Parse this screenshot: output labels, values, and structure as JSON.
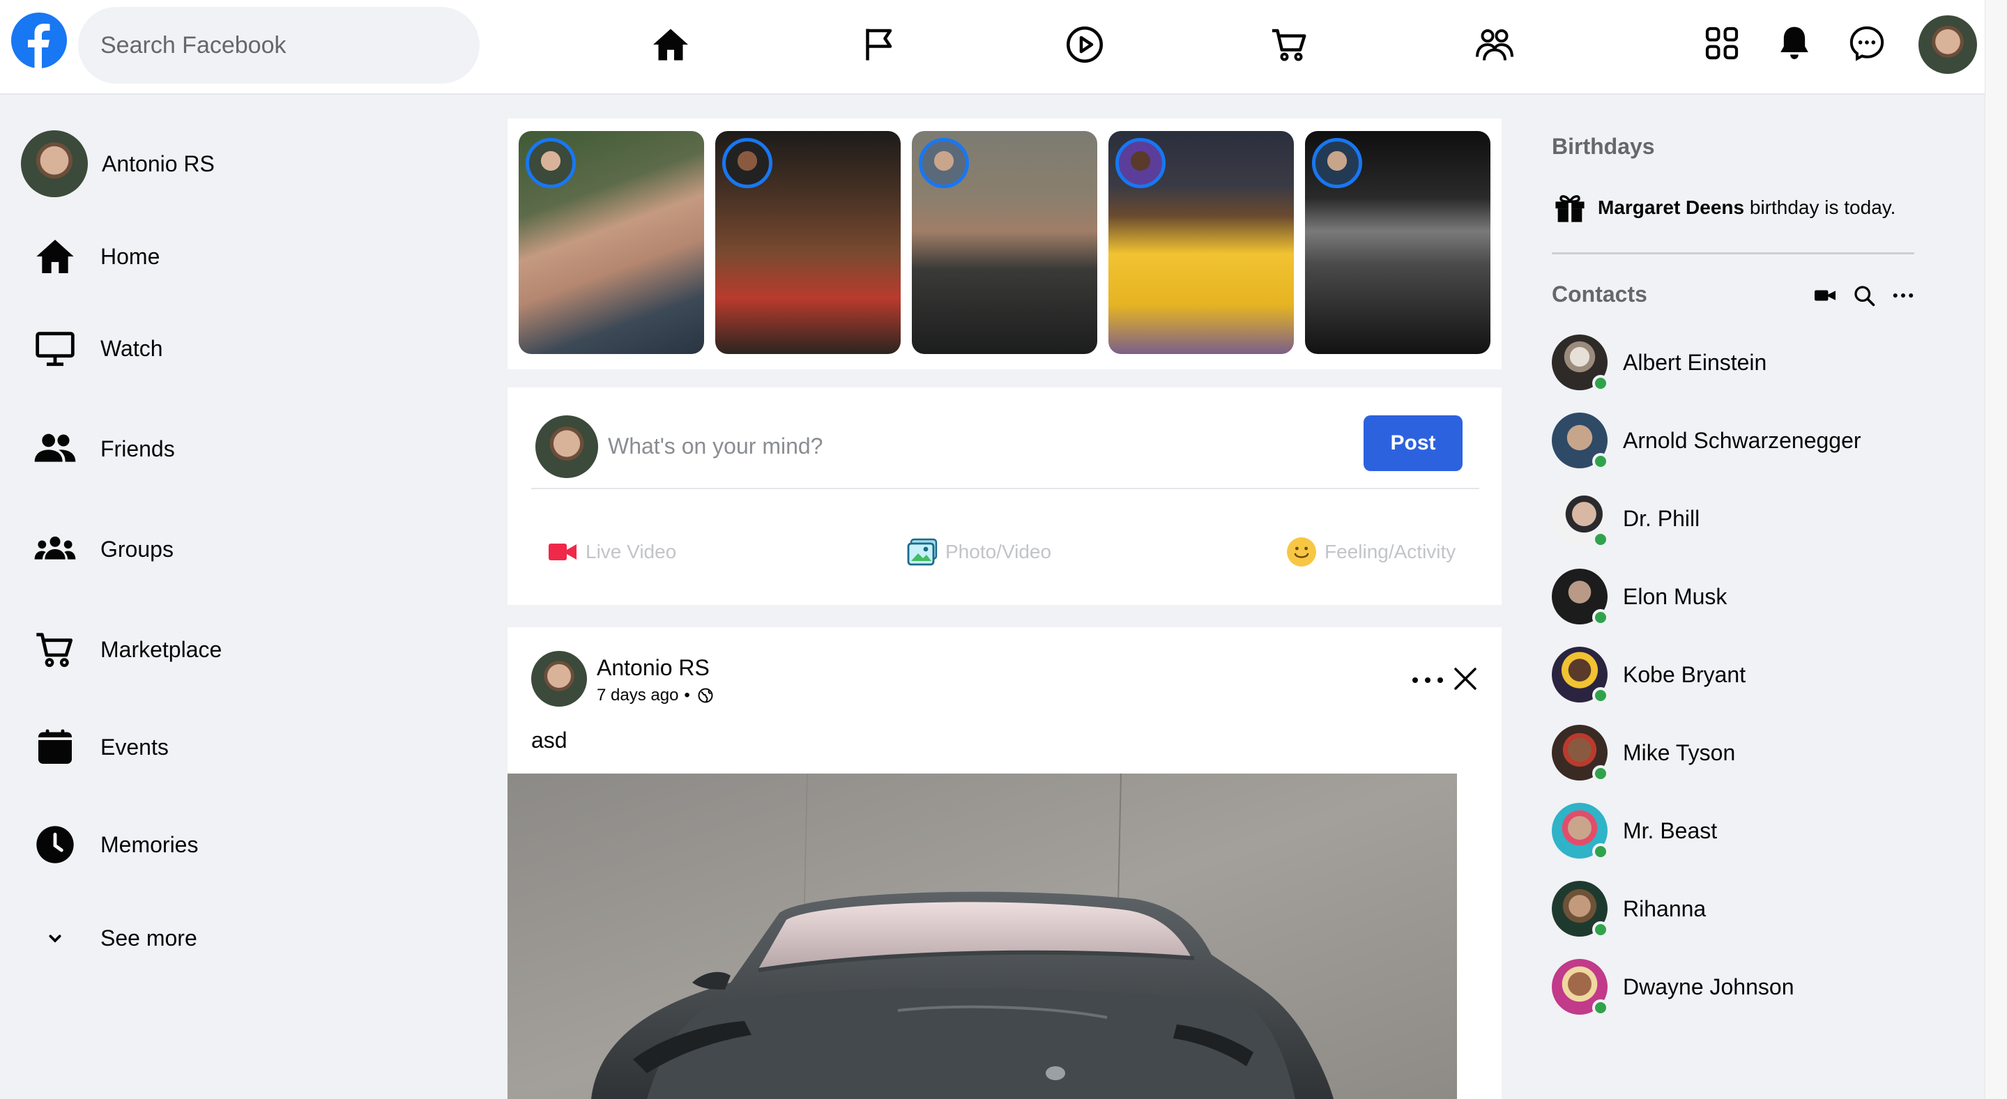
{
  "topbar": {
    "search_placeholder": "Search Facebook",
    "nav_icons": [
      "home-icon",
      "flag-icon",
      "play-icon",
      "cart-icon",
      "groups-icon"
    ],
    "right_icons": [
      "menu-grid-icon",
      "bell-icon",
      "messenger-icon"
    ]
  },
  "sidebar": {
    "profile_name": "Antonio RS",
    "items": [
      {
        "label": "Home",
        "icon": "home-icon"
      },
      {
        "label": "Watch",
        "icon": "monitor-icon"
      },
      {
        "label": "Friends",
        "icon": "friends-icon"
      },
      {
        "label": "Groups",
        "icon": "groups-icon"
      },
      {
        "label": "Marketplace",
        "icon": "cart-icon"
      },
      {
        "label": "Events",
        "icon": "calendar-icon"
      },
      {
        "label": "Memories",
        "icon": "clock-icon"
      },
      {
        "label": "See more",
        "icon": "chevron-down-icon"
      }
    ]
  },
  "composer": {
    "placeholder": "What's on your mind?",
    "post_label": "Post",
    "actions": [
      {
        "label": "Live Video",
        "icon": "live-video-icon",
        "color": "#f02849"
      },
      {
        "label": "Photo/Video",
        "icon": "photo-icon",
        "color": "#45bd62"
      },
      {
        "label": "Feeling/Activity",
        "icon": "smiley-icon",
        "color": "#f7b928"
      }
    ]
  },
  "post": {
    "author": "Antonio RS",
    "time": "7 days ago",
    "separator": "•",
    "text": "asd"
  },
  "birthdays": {
    "title": "Birthdays",
    "name": "Margaret Deens",
    "suffix": " birthday is today."
  },
  "contacts": {
    "title": "Contacts",
    "list": [
      {
        "name": "Albert Einstein"
      },
      {
        "name": "Arnold Schwarzenegger"
      },
      {
        "name": "Dr. Phill"
      },
      {
        "name": "Elon Musk"
      },
      {
        "name": "Kobe Bryant"
      },
      {
        "name": "Mike Tyson"
      },
      {
        "name": "Mr. Beast"
      },
      {
        "name": "Rihanna"
      },
      {
        "name": "Dwayne Johnson"
      }
    ]
  },
  "colors": {
    "brand": "#1877f2",
    "post_button": "#2d62de",
    "online": "#31a24c"
  }
}
